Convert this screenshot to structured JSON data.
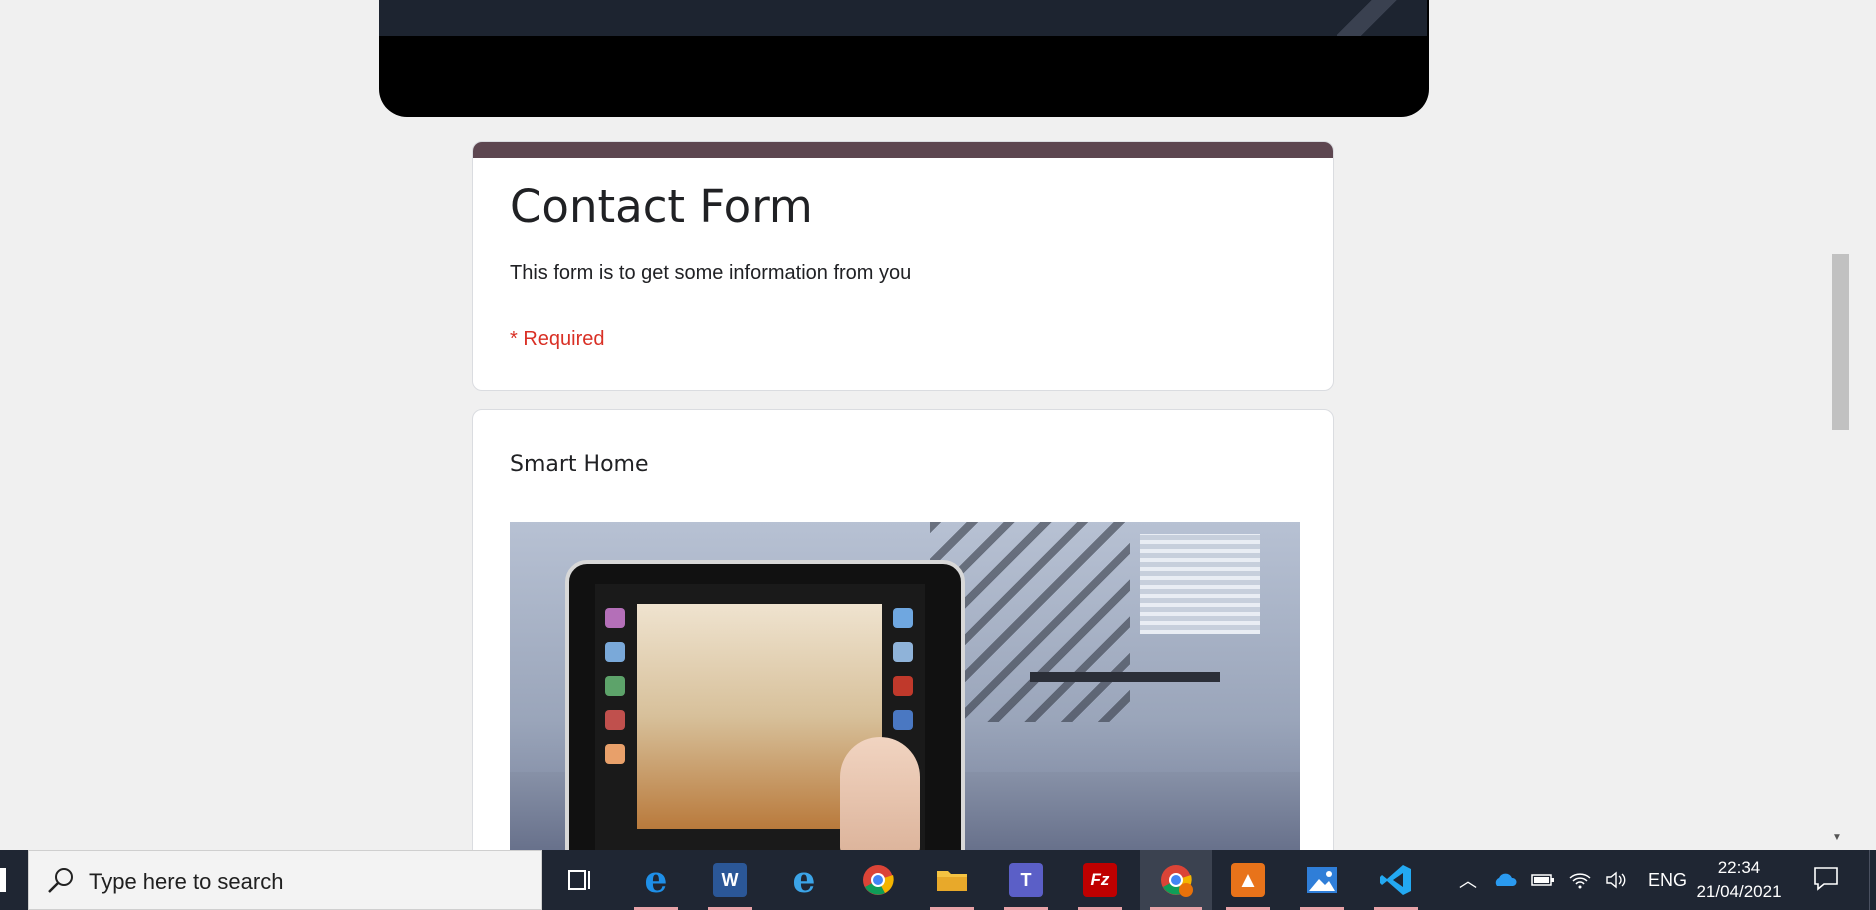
{
  "form": {
    "title": "Contact Form",
    "description": "This form is to get some information from you",
    "required_note": "* Required",
    "accent_color": "#5d4650",
    "required_color": "#d93025"
  },
  "section": {
    "title": "Smart Home"
  },
  "taskbar": {
    "search_placeholder": "Type here to search",
    "apps": [
      {
        "name": "task-view",
        "icon": "task-view-icon"
      },
      {
        "name": "edge",
        "icon": "edge-icon"
      },
      {
        "name": "word",
        "icon": "word-icon",
        "letter": "W"
      },
      {
        "name": "internet-explorer",
        "icon": "ie-icon"
      },
      {
        "name": "chrome",
        "icon": "chrome-icon"
      },
      {
        "name": "file-explorer",
        "icon": "folder-icon"
      },
      {
        "name": "teams",
        "icon": "teams-icon",
        "letter": "T"
      },
      {
        "name": "filezilla",
        "icon": "filezilla-icon",
        "letter": "Fz"
      },
      {
        "name": "chrome-active",
        "icon": "chrome-icon"
      },
      {
        "name": "app-orange",
        "icon": "orange-app-icon"
      },
      {
        "name": "photos",
        "icon": "photos-icon"
      },
      {
        "name": "vscode",
        "icon": "vscode-icon"
      }
    ],
    "tray": {
      "language": "ENG",
      "time": "22:34",
      "date": "21/04/2021"
    }
  }
}
